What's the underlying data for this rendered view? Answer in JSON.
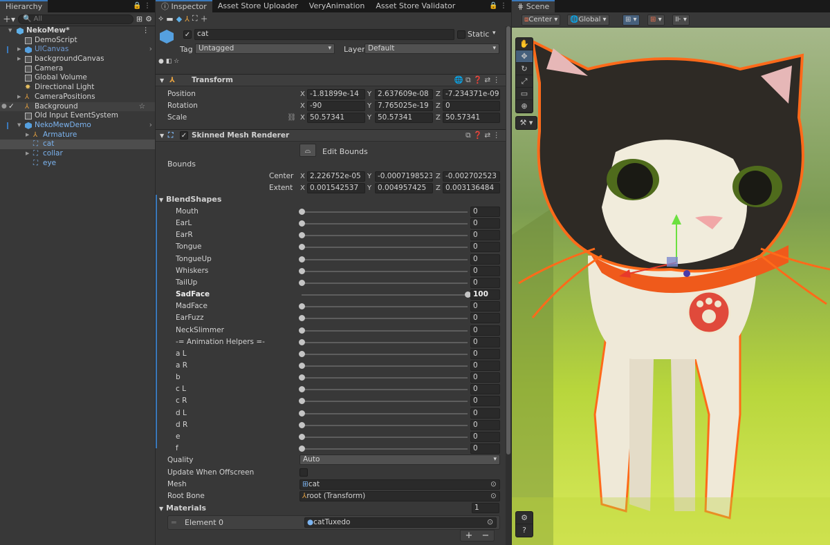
{
  "hierarchy": {
    "tab": "Hierarchy",
    "search_placeholder": "All",
    "items": [
      {
        "label": "NekoMew*",
        "depth": 0
      },
      {
        "label": "DemoScript",
        "depth": 1
      },
      {
        "label": "UICanvas",
        "depth": 1
      },
      {
        "label": "backgroundCanvas",
        "depth": 1
      },
      {
        "label": "Camera",
        "depth": 1
      },
      {
        "label": "Global Volume",
        "depth": 1
      },
      {
        "label": "Directional Light",
        "depth": 1
      },
      {
        "label": "CameraPositions",
        "depth": 1
      },
      {
        "label": "Background",
        "depth": 1
      },
      {
        "label": "Old Input EventSystem",
        "depth": 1
      },
      {
        "label": "NekoMewDemo",
        "depth": 1
      },
      {
        "label": "Armature",
        "depth": 2
      },
      {
        "label": "cat",
        "depth": 2
      },
      {
        "label": "collar",
        "depth": 2
      },
      {
        "label": "eye",
        "depth": 2
      }
    ]
  },
  "inspector": {
    "tabs": [
      "Inspector",
      "Asset Store Uploader",
      "VeryAnimation",
      "Asset Store Validator"
    ],
    "object_name": "cat",
    "static_label": "Static",
    "tag_label": "Tag",
    "tag_value": "Untagged",
    "layer_label": "Layer",
    "layer_value": "Default",
    "transform": {
      "title": "Transform",
      "position_label": "Position",
      "rotation_label": "Rotation",
      "scale_label": "Scale",
      "position": [
        "-1.81899e-14",
        "2.637609e-08",
        "-7.234371e-09"
      ],
      "rotation": [
        "-90",
        "7.765025e-19",
        "0"
      ],
      "scale": [
        "50.57341",
        "50.57341",
        "50.57341"
      ]
    },
    "axes": [
      "X",
      "Y",
      "Z"
    ],
    "smr": {
      "title": "Skinned Mesh Renderer",
      "edit_bounds": "Edit Bounds",
      "bounds_label": "Bounds",
      "center_label": "Center",
      "extent_label": "Extent",
      "center": [
        "2.226752e-05",
        "-0.0007198523",
        "-0.002702523"
      ],
      "extent": [
        "0.001542537",
        "0.004957425",
        "0.003136484"
      ],
      "blendshapes_label": "BlendShapes",
      "blendshapes": [
        {
          "name": "Mouth",
          "value": "0"
        },
        {
          "name": "EarL",
          "value": "0"
        },
        {
          "name": "EarR",
          "value": "0"
        },
        {
          "name": "Tongue",
          "value": "0"
        },
        {
          "name": "TongueUp",
          "value": "0"
        },
        {
          "name": "Whiskers",
          "value": "0"
        },
        {
          "name": "TailUp",
          "value": "0"
        },
        {
          "name": "SadFace",
          "value": "100"
        },
        {
          "name": "MadFace",
          "value": "0"
        },
        {
          "name": "EarFuzz",
          "value": "0"
        },
        {
          "name": "NeckSlimmer",
          "value": "0"
        },
        {
          "name": "-= Animation Helpers =-",
          "value": "0"
        },
        {
          "name": "a L",
          "value": "0"
        },
        {
          "name": "a R",
          "value": "0"
        },
        {
          "name": "b",
          "value": "0"
        },
        {
          "name": "c L",
          "value": "0"
        },
        {
          "name": "c R",
          "value": "0"
        },
        {
          "name": "d L",
          "value": "0"
        },
        {
          "name": "d R",
          "value": "0"
        },
        {
          "name": "e",
          "value": "0"
        },
        {
          "name": "f",
          "value": "0"
        }
      ],
      "quality_label": "Quality",
      "quality_value": "Auto",
      "update_offscreen_label": "Update When Offscreen",
      "mesh_label": "Mesh",
      "mesh_value": "cat",
      "root_bone_label": "Root Bone",
      "root_bone_value": "root (Transform)",
      "materials_label": "Materials",
      "materials_count": "1",
      "element0_label": "Element 0",
      "element0_value": "catTuxedo",
      "plus": "+",
      "minus": "−"
    }
  },
  "scene": {
    "tab": "Scene",
    "pivot": "Center",
    "space": "Global"
  },
  "colors": {
    "accent": "#3a79bb",
    "selection_outline": "#ff6a1a",
    "panel": "#383838"
  }
}
